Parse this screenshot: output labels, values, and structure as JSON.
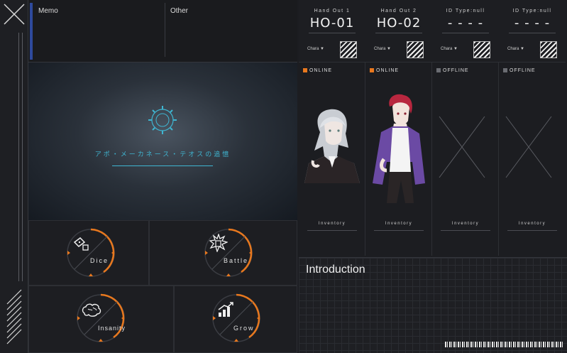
{
  "memo": {
    "label": "Memo"
  },
  "other": {
    "label": "Other"
  },
  "main_visual": {
    "title": "アポ・メーカネース・テオスの追憶"
  },
  "actions": [
    {
      "label": "Dice",
      "icon": "dice-icon"
    },
    {
      "label": "Battle",
      "icon": "battle-icon"
    },
    {
      "label": "Insanity",
      "icon": "brain-icon"
    },
    {
      "label": "Grow",
      "icon": "grow-chart-icon"
    }
  ],
  "handouts": [
    {
      "subtitle": "Hand Out 1",
      "code": "HO-01",
      "chara": "Chara ▼",
      "status": "ONLINE",
      "status_color": "#e8781e",
      "inventory": "Inventory"
    },
    {
      "subtitle": "Hand Out 2",
      "code": "HO-02",
      "chara": "Chara ▼",
      "status": "ONLINE",
      "status_color": "#e8781e",
      "inventory": "Inventory"
    },
    {
      "subtitle": "ID Type:null",
      "code": "- - - -",
      "chara": "Chara ▼",
      "status": "OFFLINE",
      "status_color": "#6a6c72",
      "inventory": "Inventory"
    },
    {
      "subtitle": "ID Type:null",
      "code": "- - - -",
      "chara": "Chara ▼",
      "status": "OFFLINE",
      "status_color": "#6a6c72",
      "inventory": "Inventory"
    }
  ],
  "intro": {
    "title": "Introduction"
  },
  "colors": {
    "accent_orange": "#e8781e",
    "accent_blue": "#2e4a9c",
    "title_cyan": "#3fb6d2"
  }
}
